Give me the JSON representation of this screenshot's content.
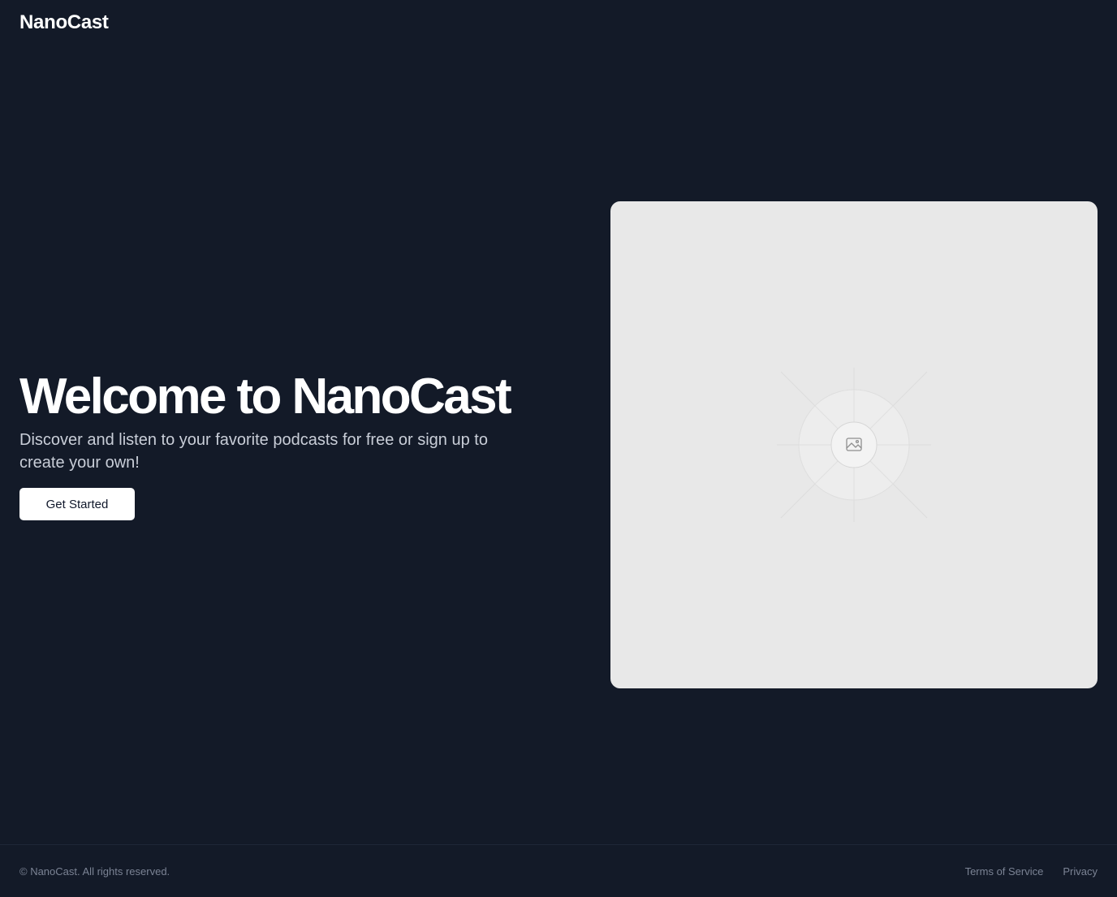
{
  "header": {
    "logo_text": "NanoCast"
  },
  "hero": {
    "title": "Welcome to NanoCast",
    "subtitle": "Discover and listen to your favorite podcasts for free or sign up to create your own!",
    "cta_label": "Get Started",
    "image_icon": "image-placeholder-icon"
  },
  "footer": {
    "copyright": "© NanoCast. All rights reserved.",
    "links": [
      {
        "label": "Terms of Service"
      },
      {
        "label": "Privacy"
      }
    ]
  },
  "colors": {
    "background": "#131a28",
    "placeholder": "#e8e8e8",
    "button_bg": "#ffffff",
    "muted_text": "#7b8394"
  }
}
